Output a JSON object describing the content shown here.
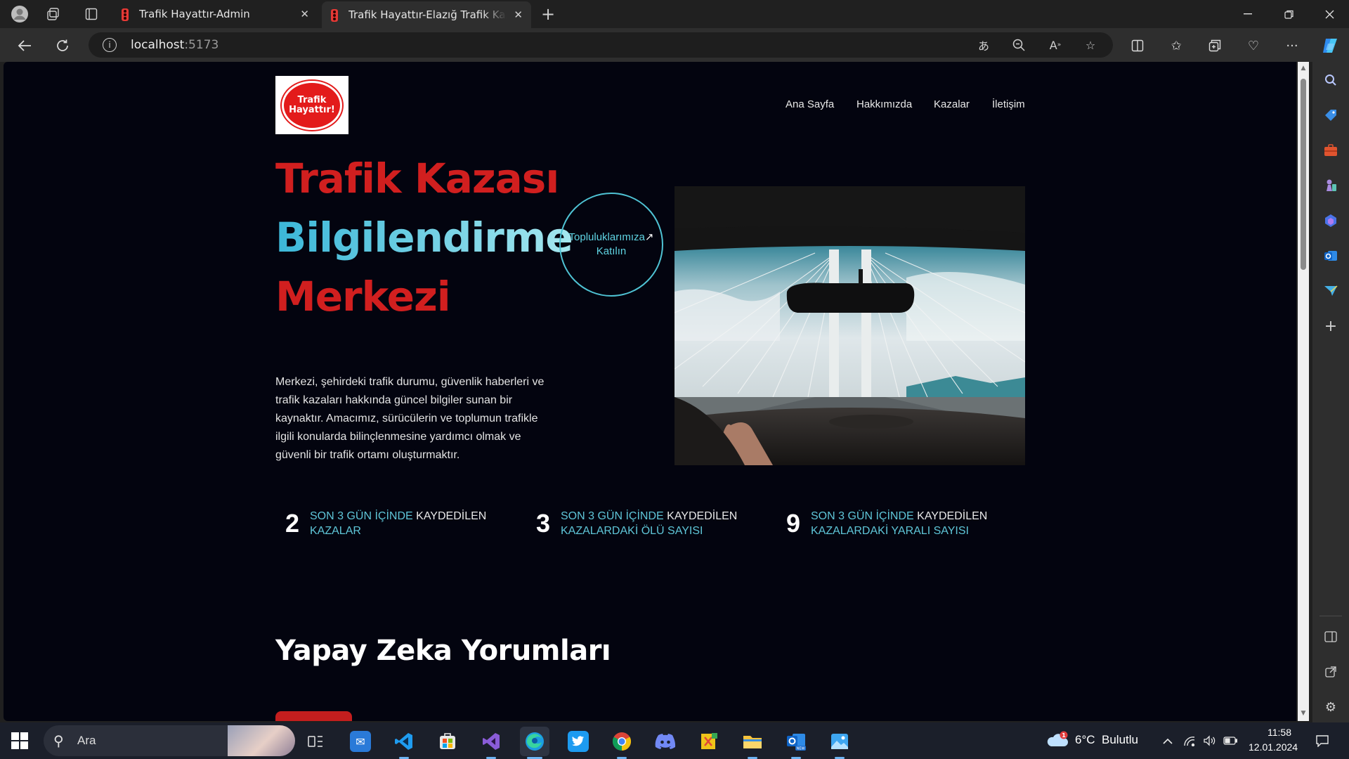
{
  "browser": {
    "tabs": [
      {
        "title": "Trafik Hayattır-Admin",
        "active": false
      },
      {
        "title": "Trafik Hayattır-Elazığ Trafik Kazası",
        "active": true
      }
    ],
    "url": {
      "host": "localhost",
      "port": ":5173"
    }
  },
  "site": {
    "logo_text": "Trafik Hayattır!",
    "nav": [
      "Ana Sayfa",
      "Hakkımızda",
      "Kazalar",
      "İletişim"
    ],
    "hero": {
      "line1": "Trafik Kazası",
      "line2": "Bilgilendirme",
      "line3": "Merkezi",
      "join_label_1": "Topluluklarımıza",
      "join_arrow": "↗",
      "join_label_2": "Katılın",
      "description": "Merkezi, şehirdeki trafik durumu, güvenlik haberleri ve trafik kazaları hakkında güncel bilgiler sunan bir kaynaktır. Amacımız, sürücülerin ve toplumun trafikle ilgili konularda bilinçlenmesine yardımcı olmak ve güvenli bir trafik ortamı oluşturmaktır."
    },
    "stats": [
      {
        "value": "2",
        "label_line1_cyan": "SON 3 GÜN İÇİNDE",
        "label_line1_white": "KAYDEDİLEN",
        "label_line2": "KAZALAR"
      },
      {
        "value": "3",
        "label_line1_cyan": "SON 3 GÜN İÇİNDE",
        "label_line1_white": "KAYDEDİLEN",
        "label_line2": "KAZALARDAKİ ÖLÜ SAYISI"
      },
      {
        "value": "9",
        "label_line1_cyan": "SON 3 GÜN İÇİNDE",
        "label_line1_white": "KAYDEDİLEN",
        "label_line2": "KAZALARDAKİ YARALI SAYISI"
      }
    ],
    "ai_section_title": "Yapay Zeka Yorumları"
  },
  "taskbar": {
    "search_placeholder": "Ara",
    "weather": {
      "temp": "6°C",
      "condition": "Bulutlu",
      "badge": "1"
    },
    "time": "11:58",
    "date": "12.01.2024"
  },
  "colors": {
    "page_bg": "#03040f",
    "accent_red": "#d11f1f",
    "accent_cyan": "#5fc6d8"
  }
}
